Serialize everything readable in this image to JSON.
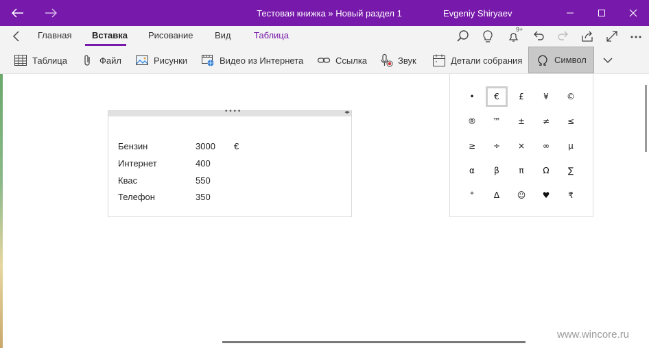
{
  "titlebar": {
    "title": "Тестовая книжка » Новый раздел 1",
    "user": "Evgeniy Shiryaev",
    "accent": "#7719aa"
  },
  "tabs": {
    "items": [
      {
        "label": "Главная"
      },
      {
        "label": "Вставка"
      },
      {
        "label": "Рисование"
      },
      {
        "label": "Вид"
      },
      {
        "label": "Таблица"
      }
    ],
    "active": "Вставка",
    "notification_badge": "9+"
  },
  "toolbar": {
    "items": [
      {
        "label": "Таблица",
        "icon": "table-icon"
      },
      {
        "label": "Файл",
        "icon": "paperclip-icon"
      },
      {
        "label": "Рисунки",
        "icon": "picture-icon"
      },
      {
        "label": "Видео из Интернета",
        "icon": "online-video-icon"
      },
      {
        "label": "Ссылка",
        "icon": "link-icon"
      },
      {
        "label": "Звук",
        "icon": "microphone-icon"
      },
      {
        "label": "Детали собрания",
        "icon": "calendar-icon"
      },
      {
        "label": "Символ",
        "icon": "omega-icon"
      }
    ],
    "selected": "Символ"
  },
  "note_table": {
    "rows": [
      {
        "item": "Бензин",
        "amount": "3000",
        "currency": "€"
      },
      {
        "item": "Интернет",
        "amount": "400",
        "currency": ""
      },
      {
        "item": "Квас",
        "amount": "550",
        "currency": ""
      },
      {
        "item": "Телефон",
        "amount": "350",
        "currency": ""
      }
    ]
  },
  "symbols": {
    "grid": [
      [
        "•",
        "€",
        "£",
        "¥",
        "©"
      ],
      [
        "®",
        "™",
        "±",
        "≠",
        "≤"
      ],
      [
        "≥",
        "÷",
        "×",
        "∞",
        "µ"
      ],
      [
        "α",
        "β",
        "π",
        "Ω",
        "∑"
      ],
      [
        "°",
        "Δ",
        "☺",
        "♥",
        "₹"
      ]
    ],
    "focused": "€"
  },
  "watermark": "www.wincore.ru"
}
